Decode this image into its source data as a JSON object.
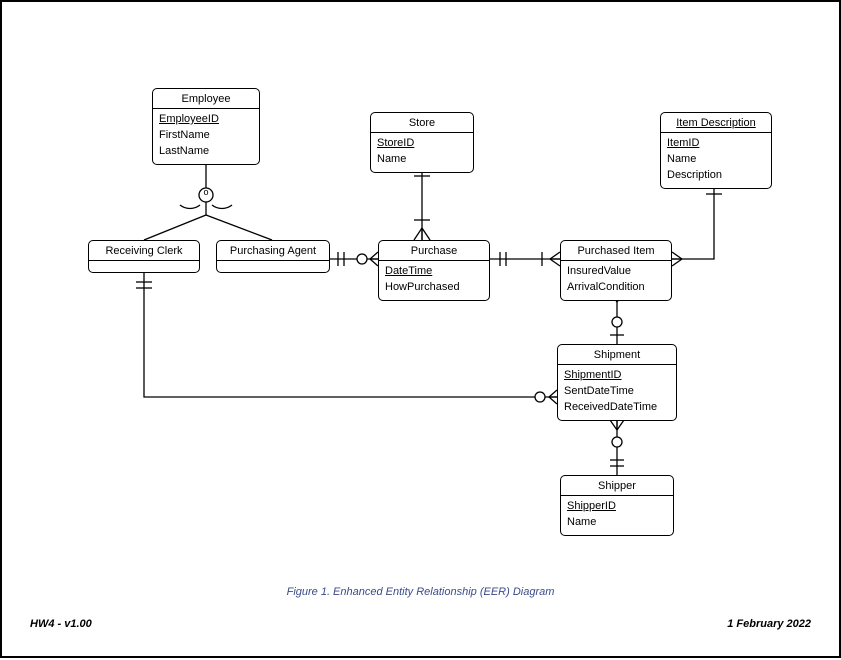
{
  "caption": "Figure 1. Enhanced Entity Relationship (EER) Diagram",
  "footer_left": "HW4 - v1.00",
  "footer_right": "1 February 2022",
  "entities": {
    "employee": {
      "title": "Employee",
      "attrs": [
        {
          "name": "EmployeeID",
          "pk": true
        },
        {
          "name": "FirstName"
        },
        {
          "name": "LastName"
        }
      ]
    },
    "store": {
      "title": "Store",
      "attrs": [
        {
          "name": "StoreID",
          "pk": true
        },
        {
          "name": "Name"
        }
      ]
    },
    "item_description": {
      "title": "Item Description",
      "attrs": [
        {
          "name": "ItemID",
          "pk": true
        },
        {
          "name": "Name"
        },
        {
          "name": "Description"
        }
      ]
    },
    "receiving_clerk": {
      "title": "Receiving Clerk",
      "attrs": []
    },
    "purchasing_agent": {
      "title": "Purchasing Agent",
      "attrs": []
    },
    "purchase": {
      "title": "Purchase",
      "attrs": [
        {
          "name": "DateTime",
          "pk": true
        },
        {
          "name": "HowPurchased"
        }
      ]
    },
    "purchased_item": {
      "title": "Purchased Item",
      "attrs": [
        {
          "name": "InsuredValue"
        },
        {
          "name": "ArrivalCondition"
        }
      ]
    },
    "shipment": {
      "title": "Shipment",
      "attrs": [
        {
          "name": "ShipmentID",
          "pk": true
        },
        {
          "name": "SentDateTime"
        },
        {
          "name": "ReceivedDateTime"
        }
      ]
    },
    "shipper": {
      "title": "Shipper",
      "attrs": [
        {
          "name": "ShipperID",
          "pk": true
        },
        {
          "name": "Name"
        }
      ]
    }
  },
  "relationships": [
    {
      "from": "Employee",
      "type": "supertype-of",
      "subtypes": [
        "Receiving Clerk",
        "Purchasing Agent"
      ],
      "constraint": "overlap"
    },
    {
      "from": "Store",
      "to": "Purchase",
      "cardinality": "1..1 to 0..*",
      "notation": "one-mandatory store, many-optional purchases"
    },
    {
      "from": "Purchasing Agent",
      "to": "Purchase",
      "cardinality": "1..1 to 0..*"
    },
    {
      "from": "Purchase",
      "to": "Purchased Item",
      "cardinality": "1..1 to 1..*"
    },
    {
      "from": "Purchased Item",
      "to": "Item Description",
      "cardinality": "0..* to 1..1"
    },
    {
      "from": "Purchased Item",
      "to": "Shipment",
      "cardinality": "0..* to 0..1"
    },
    {
      "from": "Receiving Clerk",
      "to": "Shipment",
      "cardinality": "1..1 to 0..*"
    },
    {
      "from": "Shipper",
      "to": "Shipment",
      "cardinality": "1..1 to 0..*"
    }
  ]
}
